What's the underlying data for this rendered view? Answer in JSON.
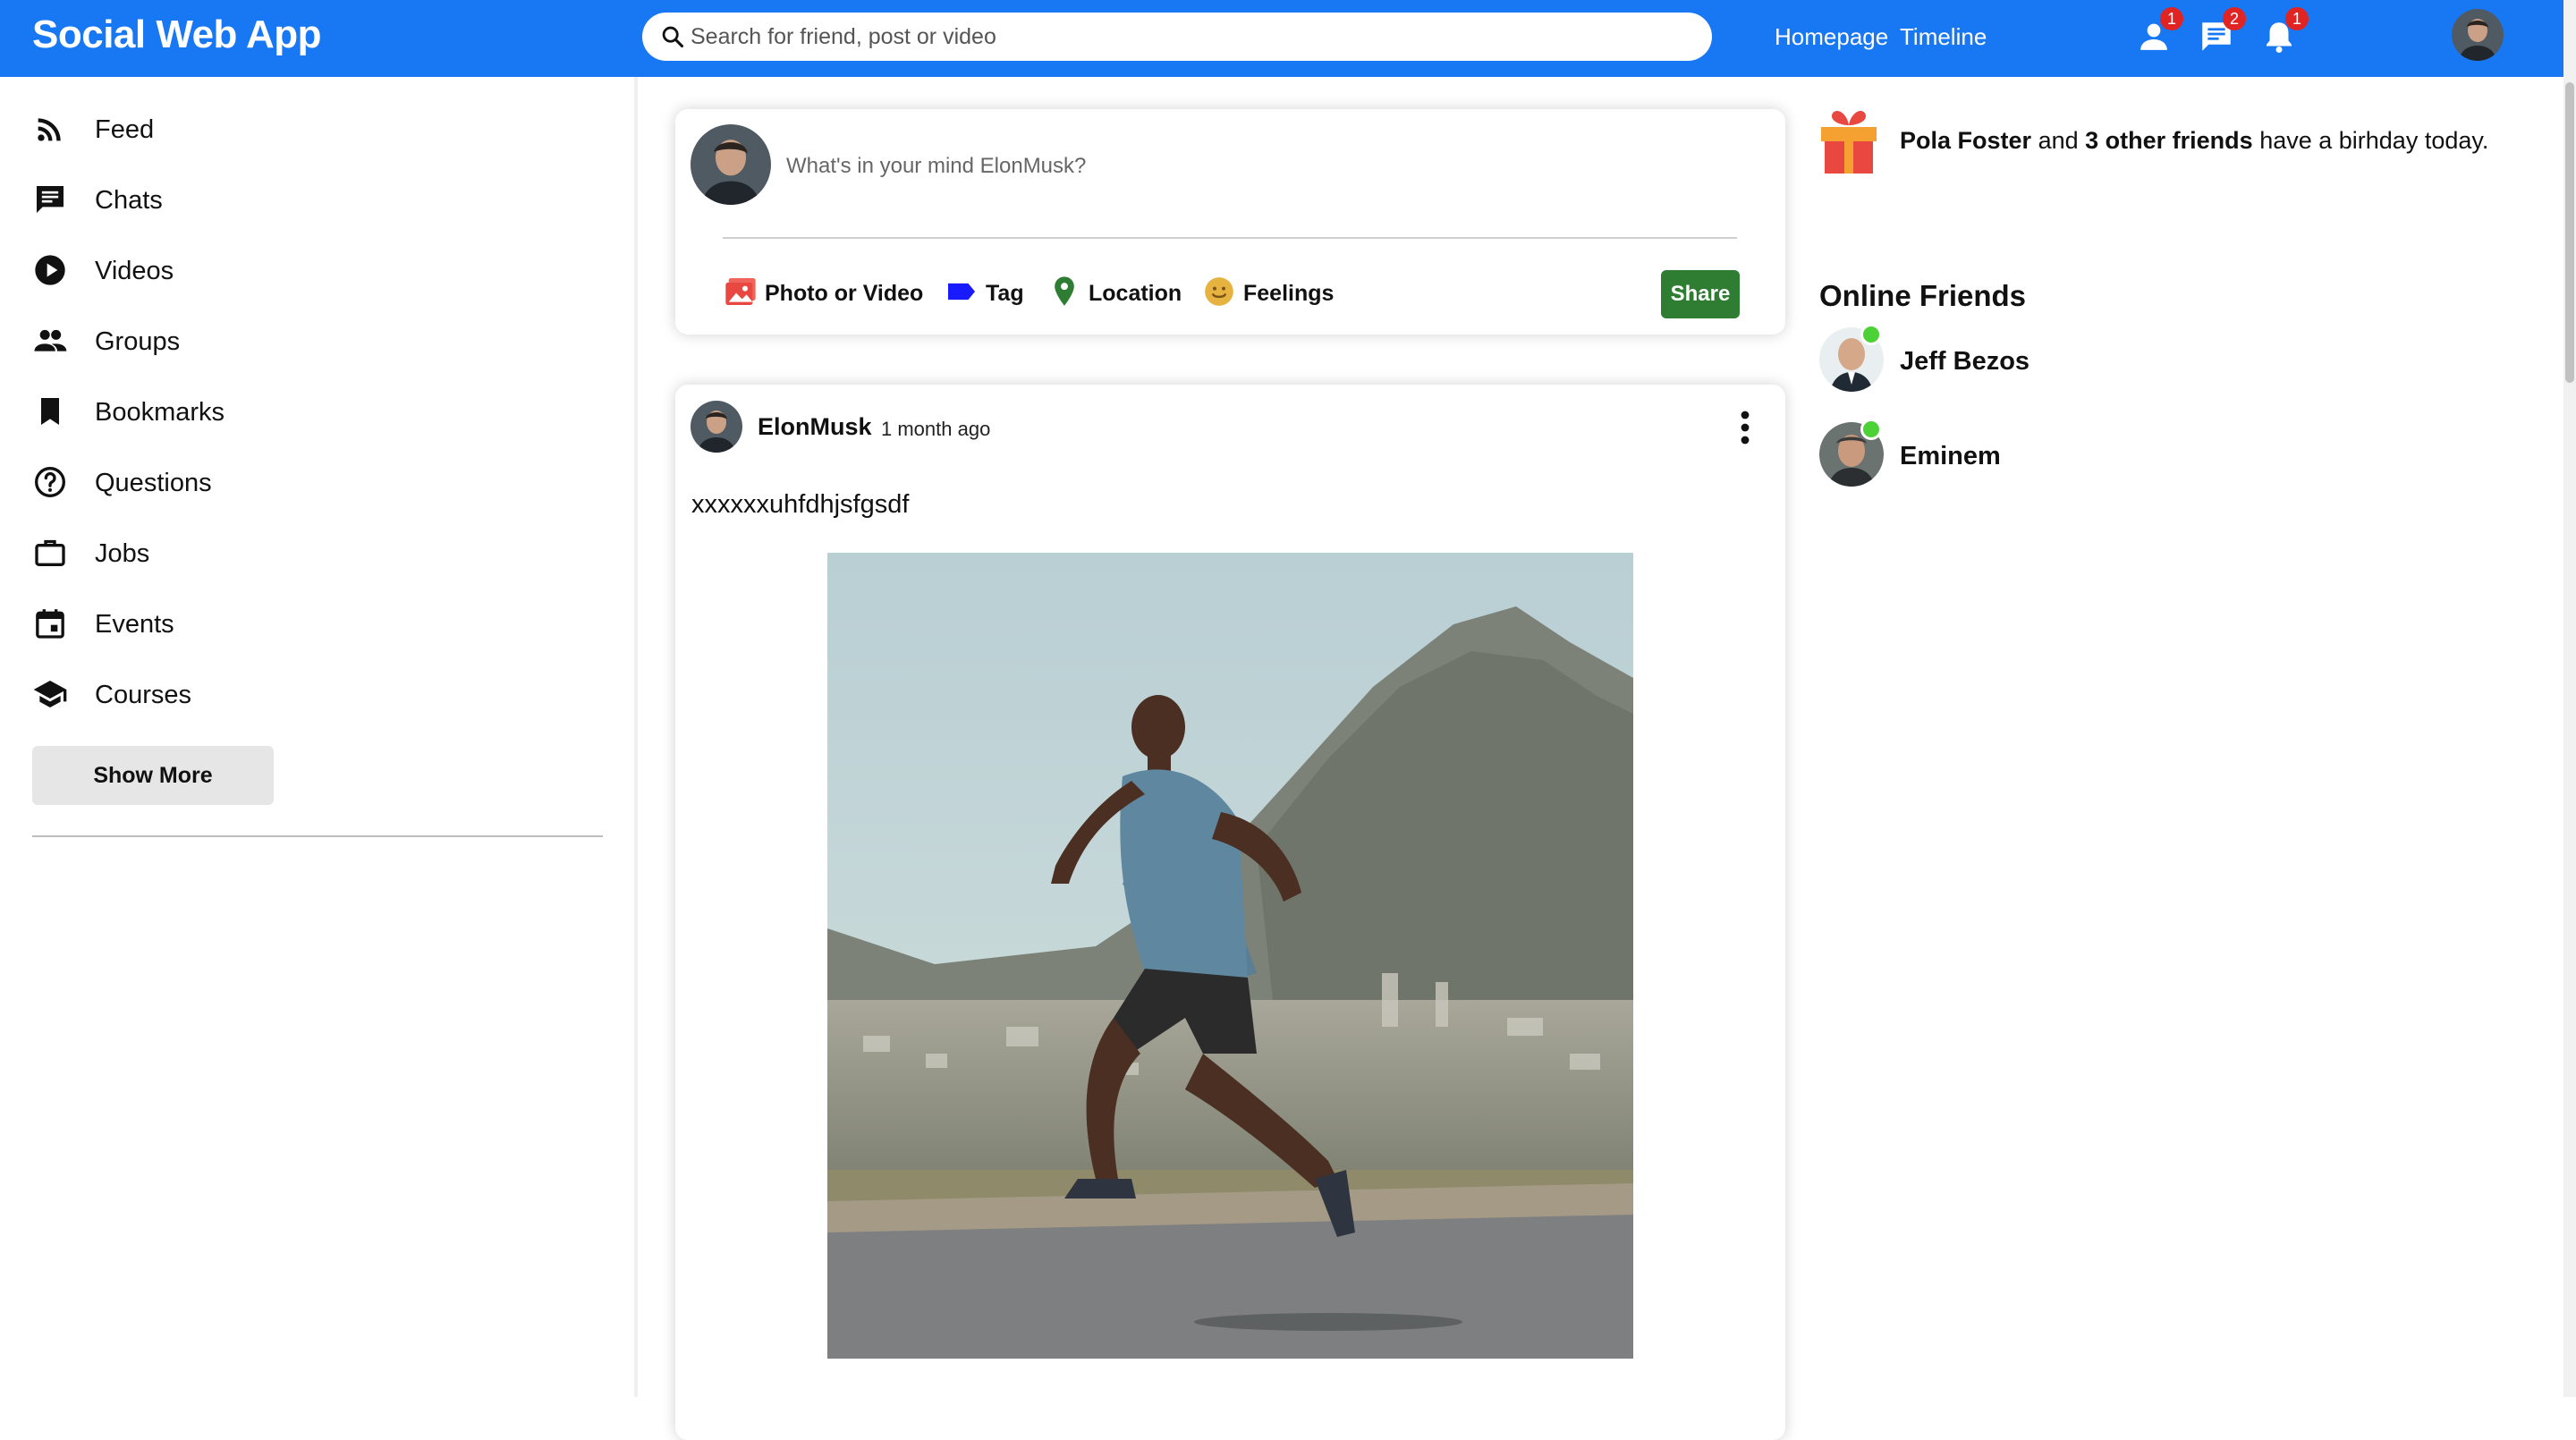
{
  "app": {
    "title": "Social Web App"
  },
  "colors": {
    "brand": "#1877f2",
    "share_button": "#2e7d32",
    "online": "#4cd137",
    "badge": "#e02424"
  },
  "search": {
    "placeholder": "Search for friend, post or video",
    "icon": "search-icon"
  },
  "topnav": {
    "links": [
      {
        "label": "Homepage"
      },
      {
        "label": "Timeline"
      }
    ],
    "icons": [
      {
        "name": "person-icon",
        "badge": "1"
      },
      {
        "name": "chat-icon",
        "badge": "2"
      },
      {
        "name": "bell-icon",
        "badge": "1"
      }
    ]
  },
  "sidebar": {
    "items": [
      {
        "label": "Feed",
        "icon": "rss-icon"
      },
      {
        "label": "Chats",
        "icon": "chat-icon"
      },
      {
        "label": "Videos",
        "icon": "play-circle-icon"
      },
      {
        "label": "Groups",
        "icon": "group-icon"
      },
      {
        "label": "Bookmarks",
        "icon": "bookmark-icon"
      },
      {
        "label": "Questions",
        "icon": "help-circle-icon"
      },
      {
        "label": "Jobs",
        "icon": "briefcase-icon"
      },
      {
        "label": "Events",
        "icon": "calendar-icon"
      },
      {
        "label": "Courses",
        "icon": "school-icon"
      }
    ],
    "show_more": "Show More"
  },
  "share": {
    "placeholder": "What's in your mind ElonMusk?",
    "options": [
      {
        "label": "Photo or Video",
        "icon": "photo-icon"
      },
      {
        "label": "Tag",
        "icon": "label-icon"
      },
      {
        "label": "Location",
        "icon": "location-pin-icon"
      },
      {
        "label": "Feelings",
        "icon": "emoji-icon"
      }
    ],
    "button": "Share"
  },
  "post": {
    "username": "ElonMusk",
    "time": "1 month ago",
    "text": "xxxxxxuhfdhjsfgsdf"
  },
  "right": {
    "birthday": {
      "name": "Pola Foster",
      "and": "and",
      "others": "3 other friends",
      "suffix": "have a birhday today."
    },
    "online_title": "Online Friends",
    "friends": [
      {
        "name": "Jeff Bezos"
      },
      {
        "name": "Eminem"
      }
    ]
  }
}
